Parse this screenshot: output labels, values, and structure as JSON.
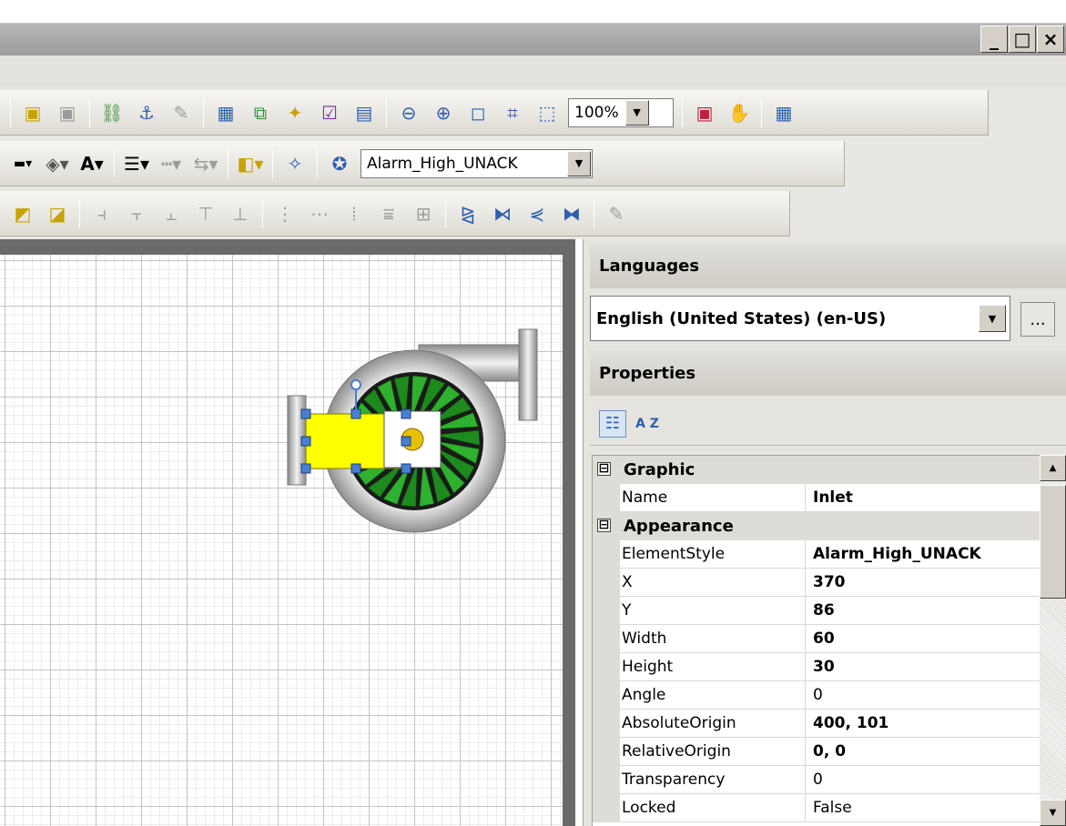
{
  "window": {
    "minimize": "_",
    "maximize": "□",
    "close": "×"
  },
  "toolbar1": {
    "zoom_value": "100%"
  },
  "toolbar2": {
    "style_value": "Alarm_High_UNACK"
  },
  "languages_panel": {
    "title": "Languages",
    "selected": "English (United States) (en-US)",
    "browse_label": "..."
  },
  "properties_panel": {
    "title": "Properties",
    "categorized_icon": "categorized-icon",
    "alphabetical_icon": "alphabetical-sort-icon",
    "alphabetical_glyph": "A Z",
    "categories": {
      "graphic": {
        "toggle": "⊟",
        "label": "Graphic"
      },
      "appearance": {
        "toggle": "⊟",
        "label": "Appearance"
      }
    },
    "rows": [
      {
        "name": "Name",
        "value": "Inlet",
        "bold": true
      },
      {
        "name": "ElementStyle",
        "value": "Alarm_High_UNACK",
        "bold": true
      },
      {
        "name": "X",
        "value": "370",
        "bold": true
      },
      {
        "name": "Y",
        "value": "86",
        "bold": true
      },
      {
        "name": "Width",
        "value": "60",
        "bold": true
      },
      {
        "name": "Height",
        "value": "30",
        "bold": true
      },
      {
        "name": "Angle",
        "value": "0",
        "bold": false
      },
      {
        "name": "AbsoluteOrigin",
        "value": "400, 101",
        "bold": true
      },
      {
        "name": "RelativeOrigin",
        "value": "0, 0",
        "bold": true
      },
      {
        "name": "Transparency",
        "value": "0",
        "bold": false
      },
      {
        "name": "Locked",
        "value": "False",
        "bold": false
      }
    ]
  },
  "colors": {
    "selected_element_fill": "#ffff00",
    "selection_handle": "#4a7fcf",
    "impeller_green": "#1e8a1e",
    "window_title_gray": "#a8a8a8"
  }
}
